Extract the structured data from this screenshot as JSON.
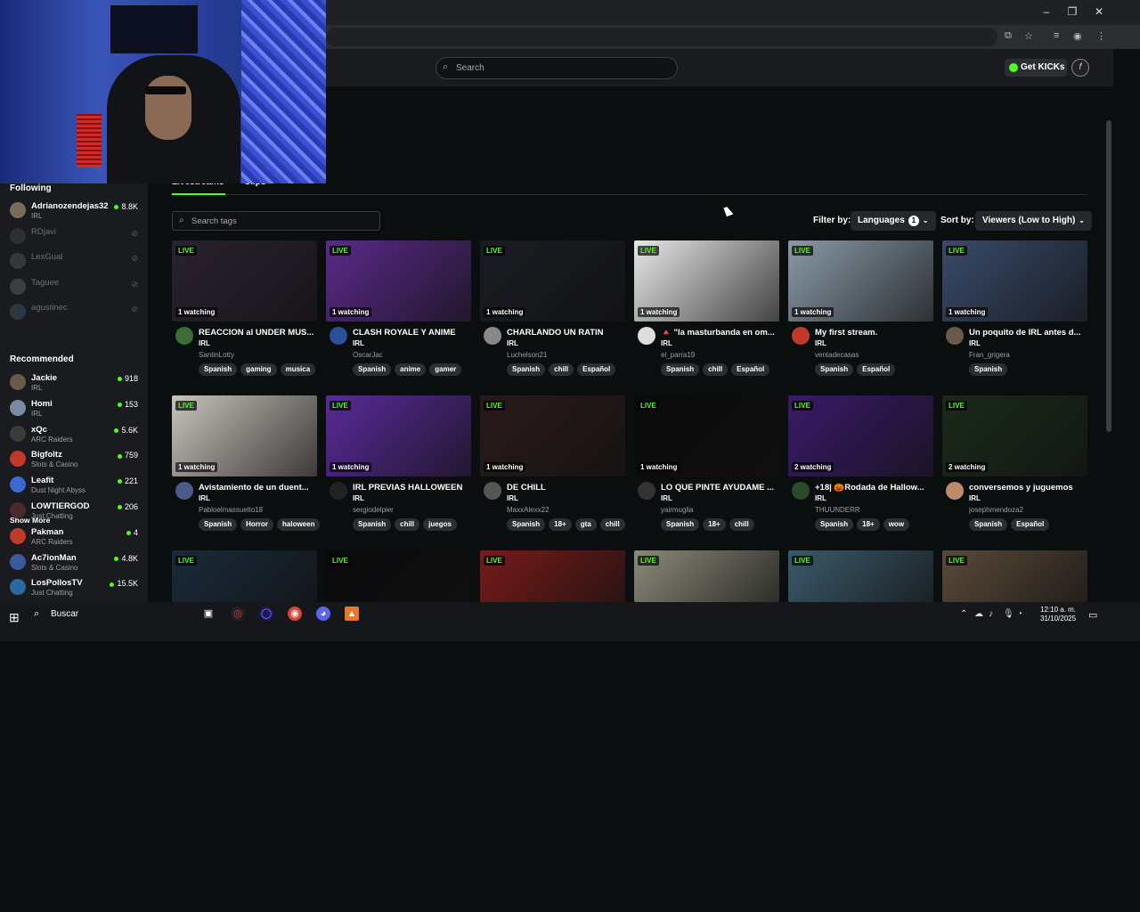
{
  "window": {
    "minimize": "–",
    "restore": "❐",
    "close": "✕"
  },
  "header": {
    "search_placeholder": "Search",
    "get_kicks_label": "Get KICKs",
    "brand_color": "#53fc18"
  },
  "sidebar": {
    "following_heading": "Following",
    "following": [
      {
        "name": "Adrianozendejas32",
        "category": "IRL",
        "viewers": "8.8K",
        "online": true
      },
      {
        "name": "RDjavi",
        "category": "",
        "viewers": "",
        "online": false
      },
      {
        "name": "LexGual",
        "category": "",
        "viewers": "",
        "online": false
      },
      {
        "name": "Taguee",
        "category": "",
        "viewers": "",
        "online": false
      },
      {
        "name": "agustinec",
        "category": "",
        "viewers": "",
        "online": false
      }
    ],
    "show_more_label": "Show More",
    "recommended_heading": "Recommended",
    "recommended": [
      {
        "name": "Jackie",
        "category": "IRL",
        "viewers": "918"
      },
      {
        "name": "Homi",
        "category": "IRL",
        "viewers": "153"
      },
      {
        "name": "xQc",
        "category": "ARC Raiders",
        "viewers": "5.6K"
      },
      {
        "name": "Bigfoltz",
        "category": "Slots & Casino",
        "viewers": "759"
      },
      {
        "name": "Leafit",
        "category": "Dust Night Abyss",
        "viewers": "221"
      },
      {
        "name": "LOWTIERGOD",
        "category": "Just Chatting",
        "viewers": "206"
      },
      {
        "name": "Pakman",
        "category": "ARC Raiders",
        "viewers": "4"
      },
      {
        "name": "Ac7ionMan",
        "category": "Slots & Casino",
        "viewers": "4.8K"
      },
      {
        "name": "LosPollosTV",
        "category": "Just Chatting",
        "viewers": "15.5K"
      }
    ]
  },
  "main": {
    "tabs": [
      {
        "label": "Livestreams"
      },
      {
        "label": "Clips"
      }
    ],
    "tag_search_placeholder": "Search tags",
    "filter_label": "Filter by:",
    "languages_label": "Languages",
    "languages_count": "1",
    "sort_label": "Sort by:",
    "sort_value": "Viewers (Low to High)",
    "live_badge": "LIVE",
    "streams": [
      {
        "title": "REACCION al UNDER MUS...",
        "category": "IRL",
        "user": "SantinLotty",
        "watching": "1 watching",
        "tags": [
          "Spanish",
          "gaming",
          "musica"
        ],
        "thumb_color": "#2a2230",
        "avatar_color": "#3d6b3a"
      },
      {
        "title": "CLASH ROYALE Y ANIME",
        "category": "IRL",
        "user": "OscarJac",
        "watching": "1 watching",
        "tags": [
          "Spanish",
          "anime",
          "gamer"
        ],
        "thumb_color": "#5a2a8a",
        "avatar_color": "#2d4f9a"
      },
      {
        "title": "CHARLANDO UN RATIN",
        "category": "IRL",
        "user": "Luchelson21",
        "watching": "1 watching",
        "tags": [
          "Spanish",
          "chill",
          "Español"
        ],
        "thumb_color": "#1a1c22",
        "avatar_color": "#888888"
      },
      {
        "title": "🔺 \"la masturbanda en om...",
        "category": "IRL",
        "user": "el_parra19",
        "watching": "1 watching",
        "tags": [
          "Spanish",
          "chill",
          "Español"
        ],
        "thumb_color": "#e8e8e8",
        "avatar_color": "#dddddd"
      },
      {
        "title": "My first stream.",
        "category": "IRL",
        "user": "ventadecasas",
        "watching": "1 watching",
        "tags": [
          "Spanish",
          "Español"
        ],
        "thumb_color": "#8a9aa8",
        "avatar_color": "#c0392b"
      },
      {
        "title": "Un poquito de IRL antes d...",
        "category": "IRL",
        "user": "Fran_grigera",
        "watching": "1 watching",
        "tags": [
          "Spanish"
        ],
        "thumb_color": "#3a4a6a",
        "avatar_color": "#6b5a4a"
      },
      {
        "title": "Avistamiento de un duent...",
        "category": "IRL",
        "user": "Pabloelmassuelto18",
        "watching": "1 watching",
        "tags": [
          "Spanish",
          "Horror",
          "haloween"
        ],
        "thumb_color": "#c8c4bc",
        "avatar_color": "#4a5a8a"
      },
      {
        "title": "IRL PREVIAS HALLOWEEN",
        "category": "IRL",
        "user": "sergiodelpier",
        "watching": "1 watching",
        "tags": [
          "Spanish",
          "chill",
          "juegos"
        ],
        "thumb_color": "#5a2a9a",
        "avatar_color": "#222222"
      },
      {
        "title": "DE CHILL",
        "category": "IRL",
        "user": "MaxxAlexx22",
        "watching": "1 watching",
        "tags": [
          "Spanish",
          "18+",
          "gta",
          "chill"
        ],
        "thumb_color": "#2a1a1a",
        "avatar_color": "#555555"
      },
      {
        "title": "LO QUE PINTE AYUDAME ...",
        "category": "IRL",
        "user": "yairmuglia",
        "watching": "1 watching",
        "tags": [
          "Spanish",
          "18+",
          "chill"
        ],
        "thumb_color": "#0a0a0a",
        "avatar_color": "#333333"
      },
      {
        "title": "+18| 🎃Rodada de Hallow...",
        "category": "IRL",
        "user": "THUUNDERR",
        "watching": "2 watching",
        "tags": [
          "Spanish",
          "18+",
          "wow"
        ],
        "thumb_color": "#3a1a6a",
        "avatar_color": "#2a4a2a"
      },
      {
        "title": "conversemos y juguemos",
        "category": "IRL",
        "user": "josephmendoza2",
        "watching": "2 watching",
        "tags": [
          "Spanish",
          "Español"
        ],
        "thumb_color": "#1a2a1a",
        "avatar_color": "#c08a6a"
      },
      {
        "title": "",
        "category": "",
        "user": "",
        "watching": "",
        "tags": [],
        "thumb_color": "#1a2a3a",
        "avatar_color": "#000000"
      },
      {
        "title": "",
        "category": "",
        "user": "",
        "watching": "",
        "tags": [],
        "thumb_color": "#0a0a0c",
        "avatar_color": "#000000"
      },
      {
        "title": "",
        "category": "",
        "user": "",
        "watching": "",
        "tags": [],
        "thumb_color": "#7a1a1a",
        "avatar_color": "#000000"
      },
      {
        "title": "",
        "category": "",
        "user": "",
        "watching": "",
        "tags": [],
        "thumb_color": "#8a8a7a",
        "avatar_color": "#000000"
      },
      {
        "title": "",
        "category": "",
        "user": "",
        "watching": "",
        "tags": [],
        "thumb_color": "#3a5a6a",
        "avatar_color": "#000000"
      },
      {
        "title": "",
        "category": "",
        "user": "",
        "watching": "",
        "tags": [],
        "thumb_color": "#5a4a3a",
        "avatar_color": "#000000"
      }
    ]
  },
  "taskbar": {
    "search_label": "Buscar",
    "time": "12:10 a. m.",
    "date": "31/10/2025"
  }
}
